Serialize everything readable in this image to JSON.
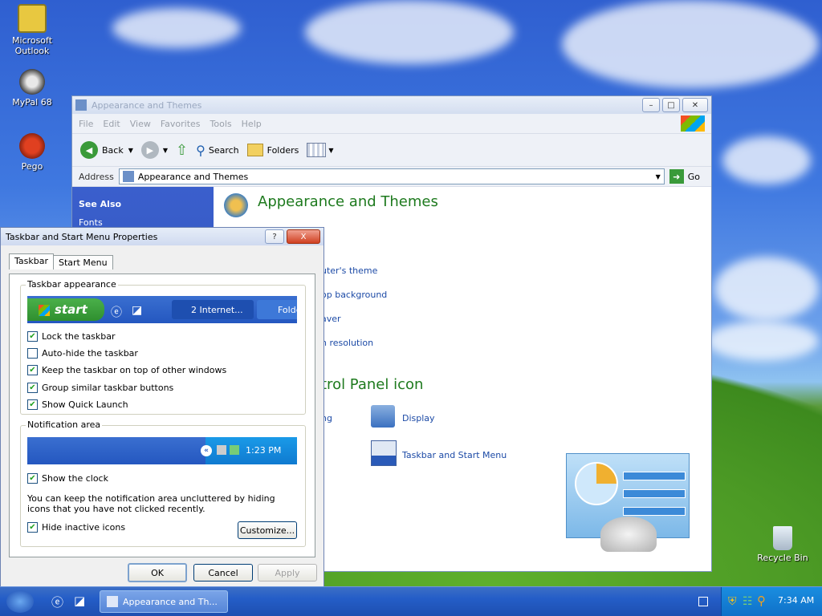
{
  "desktop": {
    "icons": [
      {
        "label_l1": "Microsoft",
        "label_l2": "Outlook"
      },
      {
        "label_l1": "MyPal 68",
        "label_l2": ""
      },
      {
        "label_l1": "Pego",
        "label_l2": ""
      },
      {
        "label_l1": "Recycle Bin",
        "label_l2": ""
      }
    ]
  },
  "explorer": {
    "title": "Appearance and Themes",
    "menu": [
      "File",
      "Edit",
      "View",
      "Favorites",
      "Tools",
      "Help"
    ],
    "toolbar": {
      "back": "Back",
      "search": "Search",
      "folders": "Folders"
    },
    "address_label": "Address",
    "address_value": "Appearance and Themes",
    "go_label": "Go",
    "see_also": "See Also",
    "sidebar_partial": "Fonts",
    "heading": "Appearance and Themes",
    "tasks": [
      "uter's theme",
      "op background",
      "aver",
      "n resolution"
    ],
    "cp_heading": "trol Panel icon",
    "cp_left_partial": "ng",
    "cp_items": [
      "Display",
      "Taskbar and Start Menu"
    ]
  },
  "dialog": {
    "title": "Taskbar and Start Menu Properties",
    "help": "?",
    "close": "X",
    "tabs": [
      "Taskbar",
      "Start Menu"
    ],
    "appearance_legend": "Taskbar appearance",
    "preview": {
      "start": "start",
      "task1": "2 Internet...",
      "task2": "Folde"
    },
    "appearance_options": [
      {
        "label": "Lock the taskbar",
        "checked": true
      },
      {
        "label": "Auto-hide the taskbar",
        "checked": false
      },
      {
        "label": "Keep the taskbar on top of other windows",
        "checked": true
      },
      {
        "label": "Group similar taskbar buttons",
        "checked": true
      },
      {
        "label": "Show Quick Launch",
        "checked": true
      }
    ],
    "notification_legend": "Notification area",
    "notify_time": "1:23 PM",
    "show_clock": "Show the clock",
    "description": "You can keep the notification area uncluttered by hiding icons that you have not clicked recently.",
    "hide_inactive": "Hide inactive icons",
    "customize": "Customize...",
    "ok": "OK",
    "cancel": "Cancel",
    "apply": "Apply"
  },
  "taskbar": {
    "active_task": "Appearance and Th...",
    "clock": "7:34 AM"
  },
  "colors": {
    "taskbar_blue": "#245dc7",
    "link_blue": "#1c4aa6",
    "heading_green": "#1e7a1e",
    "sidebar_blue": "#2a4aa0"
  }
}
